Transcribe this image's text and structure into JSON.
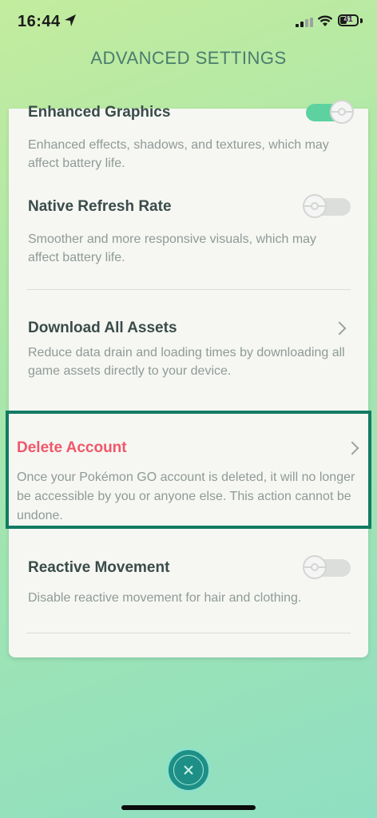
{
  "status_bar": {
    "time": "16:44",
    "battery_level": "41",
    "battery_fraction": 0.41
  },
  "title": "ADVANCED SETTINGS",
  "settings": [
    {
      "title": "Enhanced Graphics",
      "description": "Enhanced effects, shadows, and textures, which may affect battery life.",
      "control": "toggle",
      "on": true
    },
    {
      "title": "Native Refresh Rate",
      "description": "Smoother and more responsive visuals, which may affect battery life.",
      "control": "toggle",
      "on": false
    },
    {
      "title": "Download All Assets",
      "description": "Reduce data drain and loading times by downloading all game assets directly to your device.",
      "control": "chevron"
    },
    {
      "title": "Delete Account",
      "description": "Once your Pokémon GO account is deleted, it will no longer be accessible by you or anyone else. This action cannot be undone.",
      "control": "chevron",
      "danger": true
    },
    {
      "title": "Reactive Movement",
      "description": "Disable reactive movement for hair and clothing.",
      "control": "toggle",
      "on": false
    }
  ],
  "colors": {
    "accent": "#5ed1a0",
    "danger": "#f0576a",
    "highlight_border": "#137a63",
    "close_button": "#1d8f86"
  },
  "icons": {
    "close": "close-icon",
    "location": "location-arrow-icon"
  }
}
